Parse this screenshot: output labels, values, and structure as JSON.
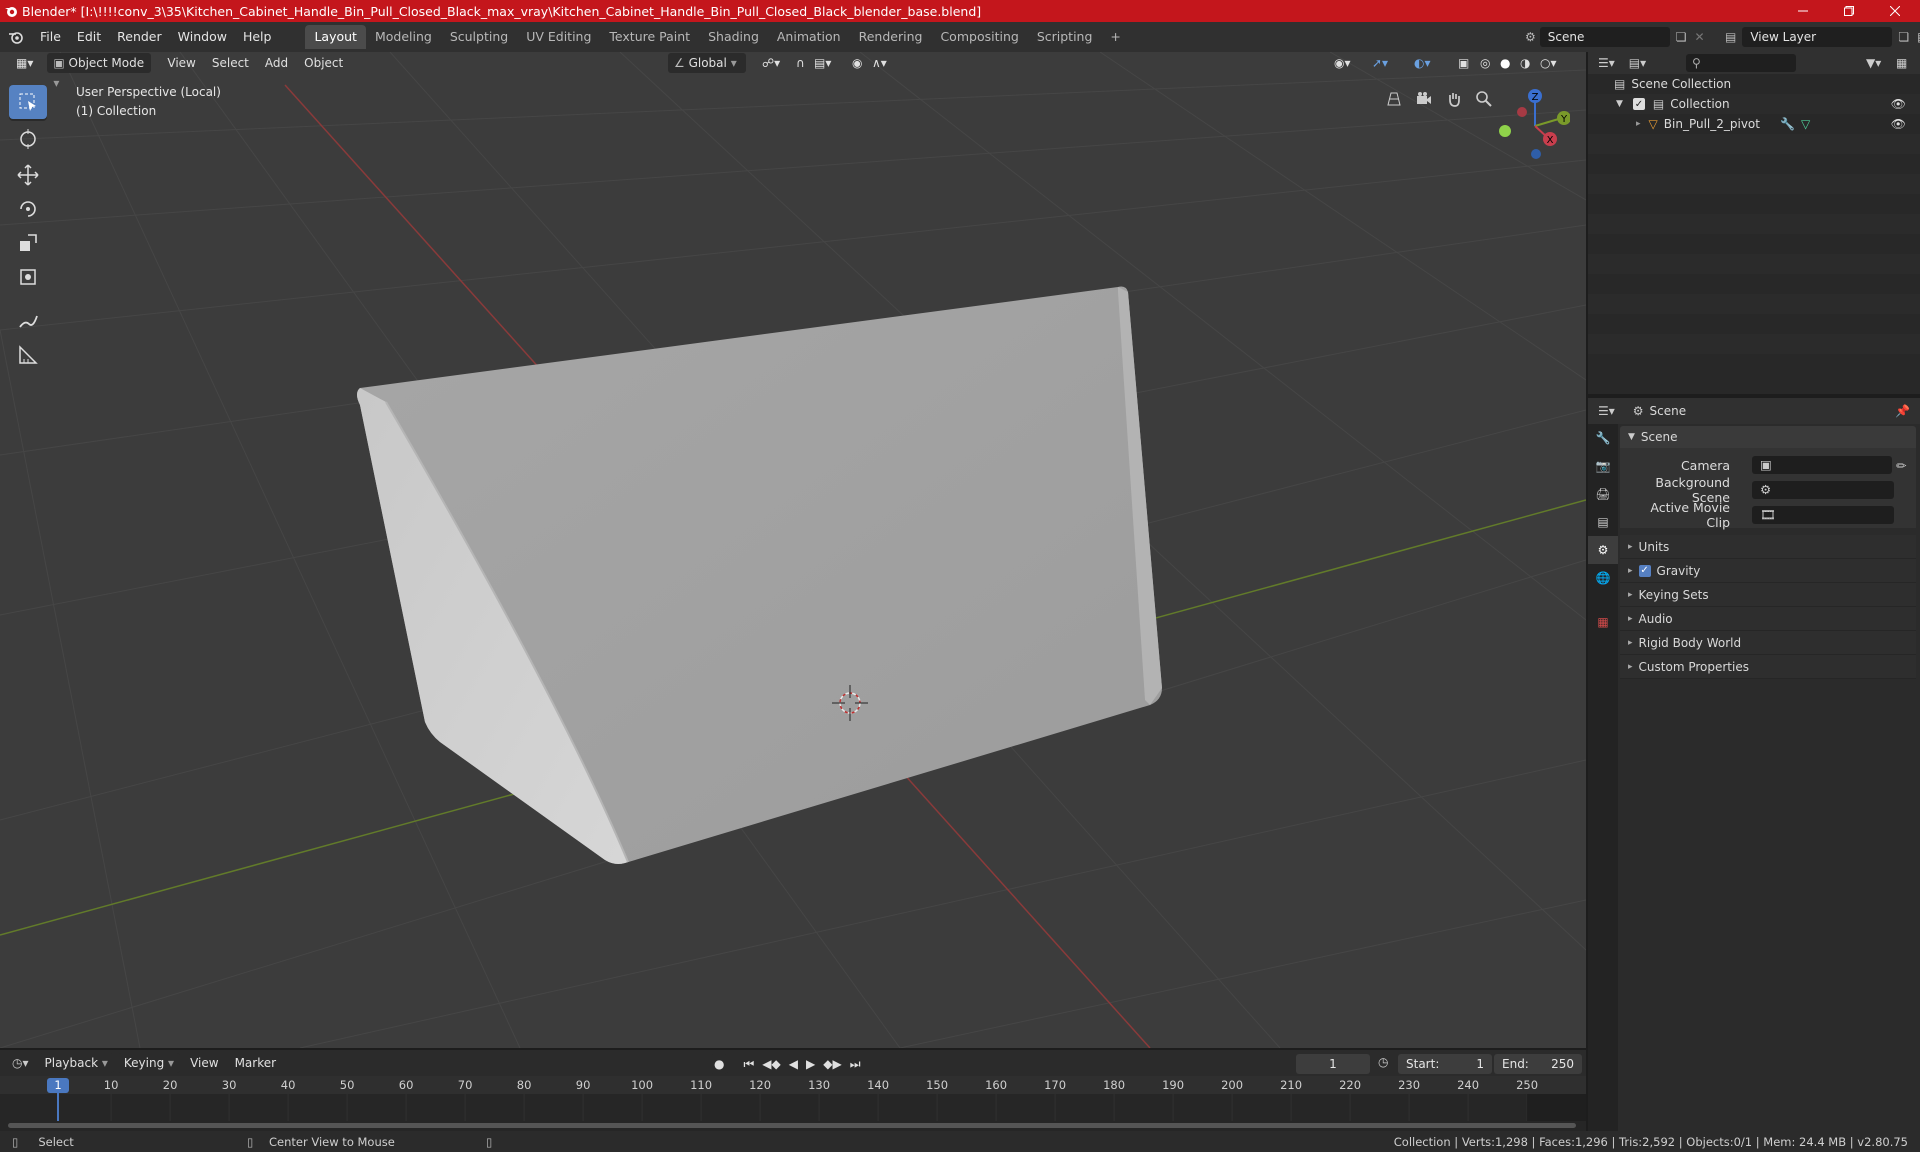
{
  "window": {
    "title": "Blender* [I:\\!!!!conv_3\\35\\Kitchen_Cabinet_Handle_Bin_Pull_Closed_Black_max_vray\\Kitchen_Cabinet_Handle_Bin_Pull_Closed_Black_blender_base.blend]",
    "accent": "#c4161c"
  },
  "menu": [
    "File",
    "Edit",
    "Render",
    "Window",
    "Help"
  ],
  "workspaces": [
    "Layout",
    "Modeling",
    "Sculpting",
    "UV Editing",
    "Texture Paint",
    "Shading",
    "Animation",
    "Rendering",
    "Compositing",
    "Scripting"
  ],
  "active_workspace": "Layout",
  "scene_field": "Scene",
  "view_layer_field": "View Layer",
  "viewport": {
    "mode": "Object Mode",
    "menus": [
      "View",
      "Select",
      "Add",
      "Object"
    ],
    "orientation": "Global",
    "overlay_text_1": "User Perspective (Local)",
    "overlay_text_2": "(1) Collection",
    "gizmo_axes": [
      "Z",
      "Y",
      "X"
    ]
  },
  "outliner": {
    "search_placeholder": "",
    "root": "Scene Collection",
    "collection": "Collection",
    "object": "Bin_Pull_2_pivot"
  },
  "properties": {
    "header": "Scene",
    "section": "Scene",
    "fields": [
      {
        "label": "Camera"
      },
      {
        "label": "Background Scene"
      },
      {
        "label": "Active Movie Clip"
      }
    ],
    "panels": [
      "Units",
      "Gravity",
      "Keying Sets",
      "Audio",
      "Rigid Body World",
      "Custom Properties"
    ],
    "gravity_checked": true
  },
  "timeline": {
    "menus": [
      "Playback",
      "Keying",
      "View",
      "Marker"
    ],
    "current_frame": "1",
    "start_label": "Start:",
    "start": "1",
    "end_label": "End:",
    "end": "250",
    "ruler": [
      "1",
      "10",
      "20",
      "30",
      "40",
      "50",
      "60",
      "70",
      "80",
      "90",
      "100",
      "110",
      "120",
      "130",
      "140",
      "150",
      "160",
      "170",
      "180",
      "190",
      "200",
      "210",
      "220",
      "230",
      "240",
      "250"
    ]
  },
  "status": {
    "left": "Select",
    "middle": "Center View to Mouse",
    "right": "Collection | Verts:1,298 | Faces:1,296 | Tris:2,592 | Objects:0/1 | Mem: 24.4 MB | v2.80.75"
  }
}
